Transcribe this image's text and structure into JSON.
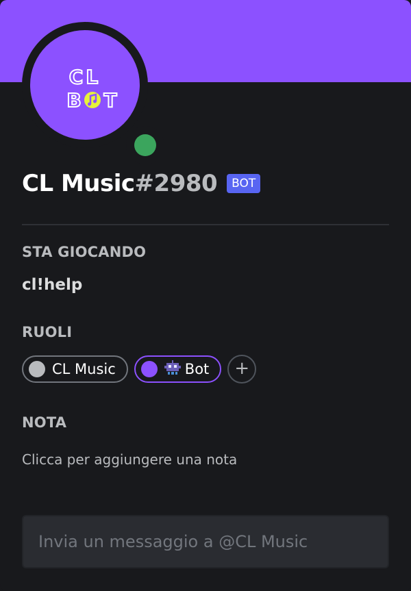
{
  "profile": {
    "banner_color": "#8c51ff",
    "avatar_text_top": "CL",
    "avatar_text_bottom": "B  T",
    "username": "CL Music",
    "discriminator": "#2980",
    "bot_badge": "BOT",
    "status": "online",
    "status_color": "#3ba55d"
  },
  "activity": {
    "title": "STA GIOCANDO",
    "name": "cl!help"
  },
  "roles": {
    "title": "RUOLI",
    "items": [
      {
        "label": "CL Music",
        "color": "#b9bbbe"
      },
      {
        "label": "Bot",
        "color": "#8c51ff",
        "icon": "robot-icon"
      }
    ],
    "add_label": "+"
  },
  "note": {
    "title": "NOTA",
    "placeholder": "Clicca per aggiungere una nota"
  },
  "message": {
    "placeholder": "Invia un messaggio a @CL Music"
  }
}
